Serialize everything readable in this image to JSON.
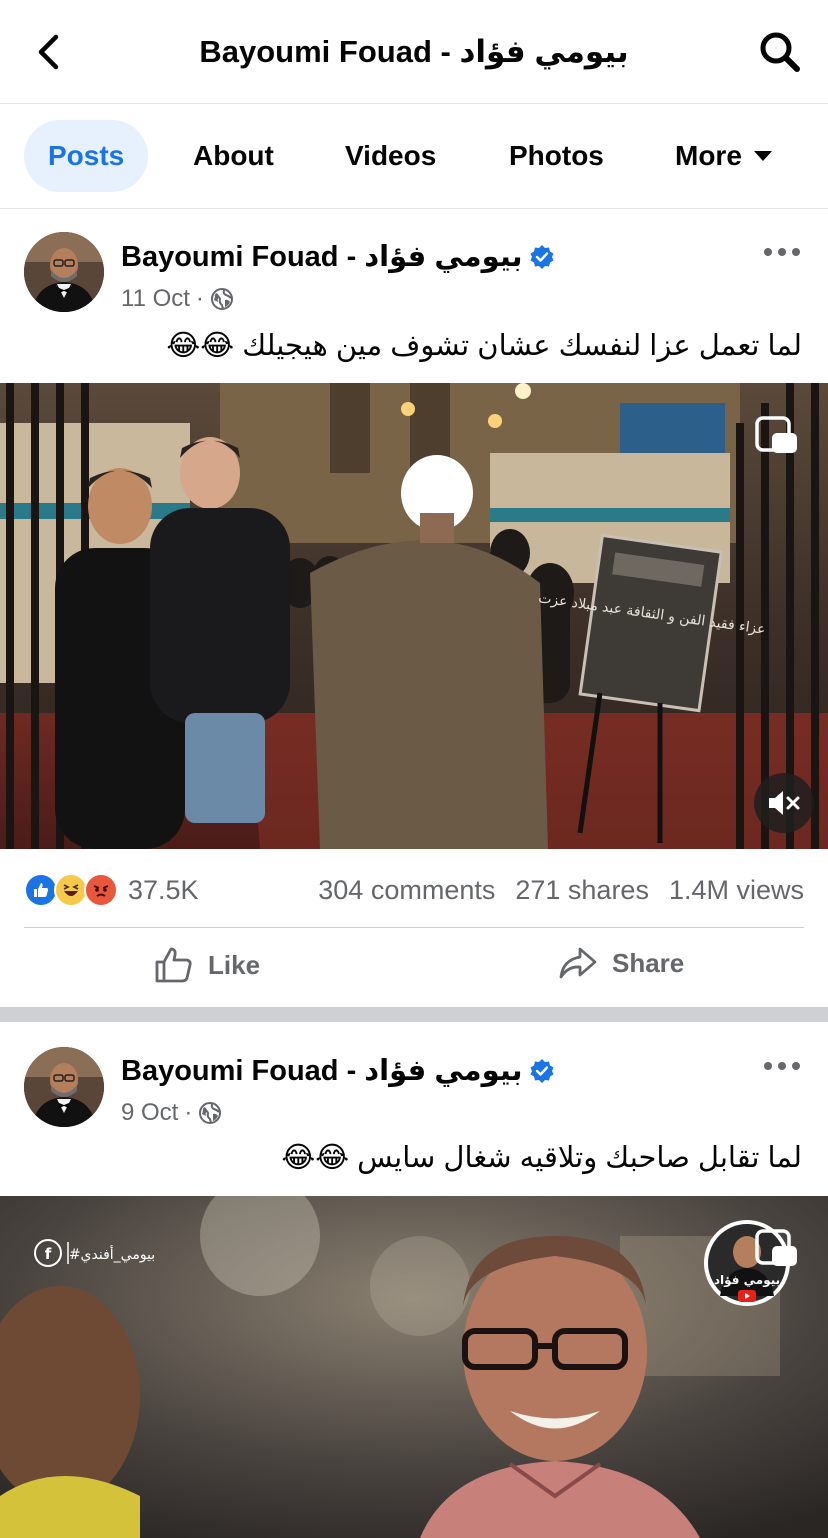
{
  "header": {
    "title": "Bayoumi Fouad - بيومي فؤاد",
    "back_icon": "chevron-left-icon",
    "search_icon": "search-icon"
  },
  "tabs": [
    {
      "label": "Posts",
      "active": true
    },
    {
      "label": "About",
      "active": false
    },
    {
      "label": "Videos",
      "active": false
    },
    {
      "label": "Photos",
      "active": false
    },
    {
      "label": "More",
      "active": false
    }
  ],
  "posts": [
    {
      "author": "Bayoumi Fouad -  بيومي  فؤاد",
      "date": "11 Oct",
      "audience_icon": "globe-icon",
      "caption": "لما تعمل عزا لنفسك عشان تشوف مين هيجيلك 😂😂",
      "sign_text": "عزاء فقيد الفن و الثقافة عبد مبلاد عزت",
      "reaction_count": "37.5K",
      "comments": "304 comments",
      "shares": "271 shares",
      "views": "1.4M views",
      "like_label": "Like",
      "share_label": "Share"
    },
    {
      "author": "Bayoumi Fouad -  بيومي  فؤاد",
      "date": "9 Oct",
      "audience_icon": "globe-icon",
      "caption": "لما تقابل صاحبك وتلاقيه شغال سايس 😂😂",
      "watermark": "#بيومي_أفندي",
      "badge_text": "بيومي فؤاد"
    }
  ],
  "colors": {
    "accent": "#1b74e4",
    "active_tab_bg": "#e7f0fd",
    "secondary_text": "#65676b",
    "separator": "#ced0d4"
  }
}
